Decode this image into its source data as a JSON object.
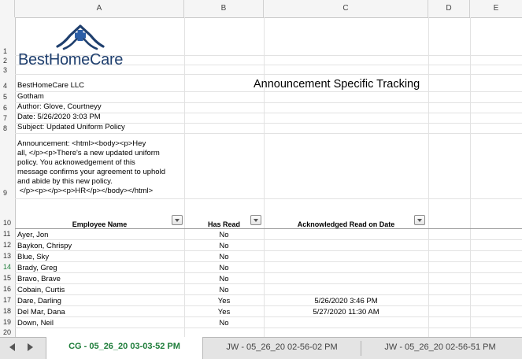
{
  "columns": [
    "A",
    "B",
    "C",
    "D",
    "E"
  ],
  "row_numbers": [
    "1",
    "2",
    "3",
    "4",
    "5",
    "6",
    "7",
    "8",
    "9",
    "10",
    "11",
    "12",
    "13",
    "14",
    "15",
    "16",
    "17",
    "18",
    "19",
    "20"
  ],
  "active_row": "14",
  "logo": {
    "word_part1": "Best",
    "word_part2": "Home",
    "word_part3": "Care",
    "brand_color": "#1f3f6e",
    "accent_color": "#2b5ea7"
  },
  "company": "BestHomeCare LLC",
  "city": "Gotham",
  "author": "Author: Glove, Courtneyy",
  "date": "Date: 5/26/2020 3:03 PM",
  "subject": "Subject: Updated Uniform Policy",
  "title": "Announcement Specific Tracking",
  "announcement_lines": [
    "Announcement: <html><body><p>Hey",
    "all, </p><p>There's a new updated uniform",
    "policy. You acknowedgement of this",
    "message confirms your agreement to uphold",
    "and abide by this new policy.",
    " </p><p></p><p>HR</p></body></html>"
  ],
  "table": {
    "headers": [
      "Employee Name",
      "Has Read",
      "Acknowledged Read on Date"
    ],
    "rows": [
      {
        "name": "Ayer, Jon",
        "has_read": "No",
        "date": ""
      },
      {
        "name": "Baykon, Chrispy",
        "has_read": "No",
        "date": ""
      },
      {
        "name": "Blue, Sky",
        "has_read": "No",
        "date": ""
      },
      {
        "name": "Brady, Greg",
        "has_read": "No",
        "date": ""
      },
      {
        "name": "Bravo, Brave",
        "has_read": "No",
        "date": ""
      },
      {
        "name": "Cobain, Curtis",
        "has_read": "No",
        "date": ""
      },
      {
        "name": "Dare, Darling",
        "has_read": "Yes",
        "date": "5/26/2020 3:46 PM"
      },
      {
        "name": "Del Mar, Dana",
        "has_read": "Yes",
        "date": "5/27/2020 11:30 AM"
      },
      {
        "name": "Down, Neil",
        "has_read": "No",
        "date": ""
      }
    ]
  },
  "sheet_tabs": [
    {
      "label": "CG - 05_26_20 03-03-52 PM",
      "active": true
    },
    {
      "label": "JW - 05_26_20 02-56-02 PM",
      "active": false
    },
    {
      "label": "JW - 05_26_20 02-56-51 PM",
      "active": false
    }
  ],
  "icons": {
    "filter": "filter-dropdown-icon",
    "prev": "scroll-left-icon",
    "next": "scroll-right-icon"
  }
}
